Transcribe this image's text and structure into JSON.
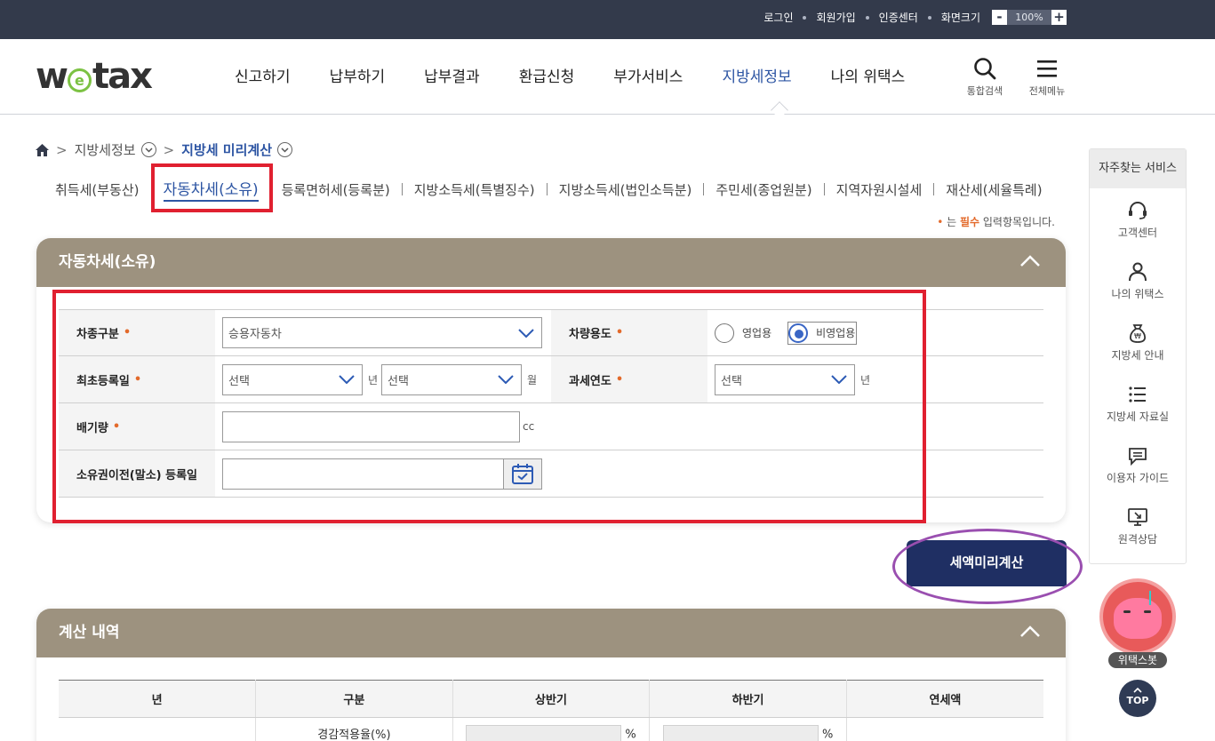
{
  "topbar": {
    "login": "로그인",
    "signup": "회원가입",
    "cert": "인증센터",
    "screen_size": "화면크기",
    "zoom_minus": "-",
    "zoom_value": "100%",
    "zoom_plus": "+"
  },
  "header": {
    "logo_pre": "w",
    "logo_e": "e",
    "logo_post": "tax",
    "menu": [
      "신고하기",
      "납부하기",
      "납부결과",
      "환급신청",
      "부가서비스",
      "지방세정보",
      "나의 위택스"
    ],
    "active_menu": "지방세정보",
    "search_label": "통합검색",
    "allmenu_label": "전체메뉴"
  },
  "breadcrumb": {
    "level1": "지방세정보",
    "level2": "지방세 미리계산"
  },
  "tax_tabs": [
    "취득세(부동산)",
    "자동차세(소유)",
    "등록면허세(등록분)",
    "지방소득세(특별징수)",
    "지방소득세(법인소득분)",
    "주민세(종업원분)",
    "지역자원시설세",
    "재산세(세율특례)"
  ],
  "required_note": {
    "dot": "•",
    "pre": " 는 ",
    "bold": "필수",
    "post": " 입력항목입니다."
  },
  "form_panel": {
    "title": "자동차세(소유)",
    "car_type_label": "차종구분",
    "car_type_value": "승용자동차",
    "usage_label": "차량용도",
    "usage_opt1": "영업용",
    "usage_opt2": "비영업용",
    "usage_selected": "비영업용",
    "first_reg_label": "최초등록일",
    "year_select": "선택",
    "year_unit": "년",
    "month_select": "선택",
    "month_unit": "월",
    "tax_year_label": "과세연도",
    "tax_year_select": "선택",
    "tax_year_unit": "년",
    "displacement_label": "배기량",
    "displacement_value": "",
    "displacement_unit": "cc",
    "transfer_label": "소유권이전(말소) 등록일",
    "transfer_value": ""
  },
  "calc_button": "세액미리계산",
  "result_panel": {
    "title": "계산 내역",
    "headers": [
      "년",
      "구분",
      "상반기",
      "하반기",
      "연세액"
    ],
    "row1_kind": "경감적용율(%)",
    "percent": "%"
  },
  "quick": {
    "title": "자주찾는 서비스",
    "items": [
      "고객센터",
      "나의 위택스",
      "지방세 안내",
      "지방세 자료실",
      "이용자 가이드",
      "원격상담"
    ]
  },
  "bot_label": "위택스봇",
  "top_label": "TOP",
  "colors": {
    "topbar": "#333a4b",
    "accent": "#2d55a3",
    "panel_head": "#9d927f",
    "calc_button": "#1f2f63",
    "required": "#e36a2b",
    "annotation_red": "#e02030",
    "annotation_purple": "#9a4fb0"
  }
}
